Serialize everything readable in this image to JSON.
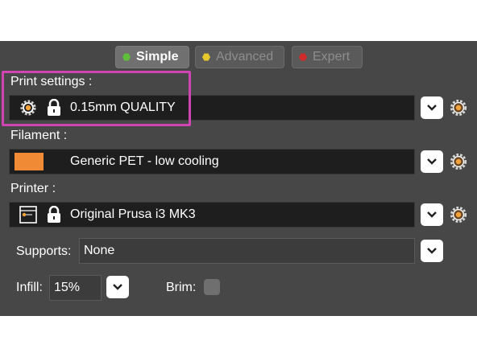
{
  "mode_tabs": [
    {
      "label": "Simple",
      "color": "#5fbf3a",
      "active": true
    },
    {
      "label": "Advanced",
      "color": "#e5c92a",
      "active": false
    },
    {
      "label": "Expert",
      "color": "#d02a2a",
      "active": false
    }
  ],
  "print_settings": {
    "label": "Print settings :",
    "value": "0.15mm QUALITY"
  },
  "filament": {
    "label": "Filament :",
    "value": "Generic PET - low cooling",
    "swatch_color": "#f08a34"
  },
  "printer": {
    "label": "Printer :",
    "value": "Original Prusa i3 MK3"
  },
  "supports": {
    "label": "Supports:",
    "value": "None"
  },
  "infill": {
    "label": "Infill:",
    "value": "15%"
  },
  "brim": {
    "label": "Brim:",
    "checked": false
  },
  "colors": {
    "panel": "#474747",
    "highlight": "#d044b4",
    "gear": "#f4a23a"
  }
}
